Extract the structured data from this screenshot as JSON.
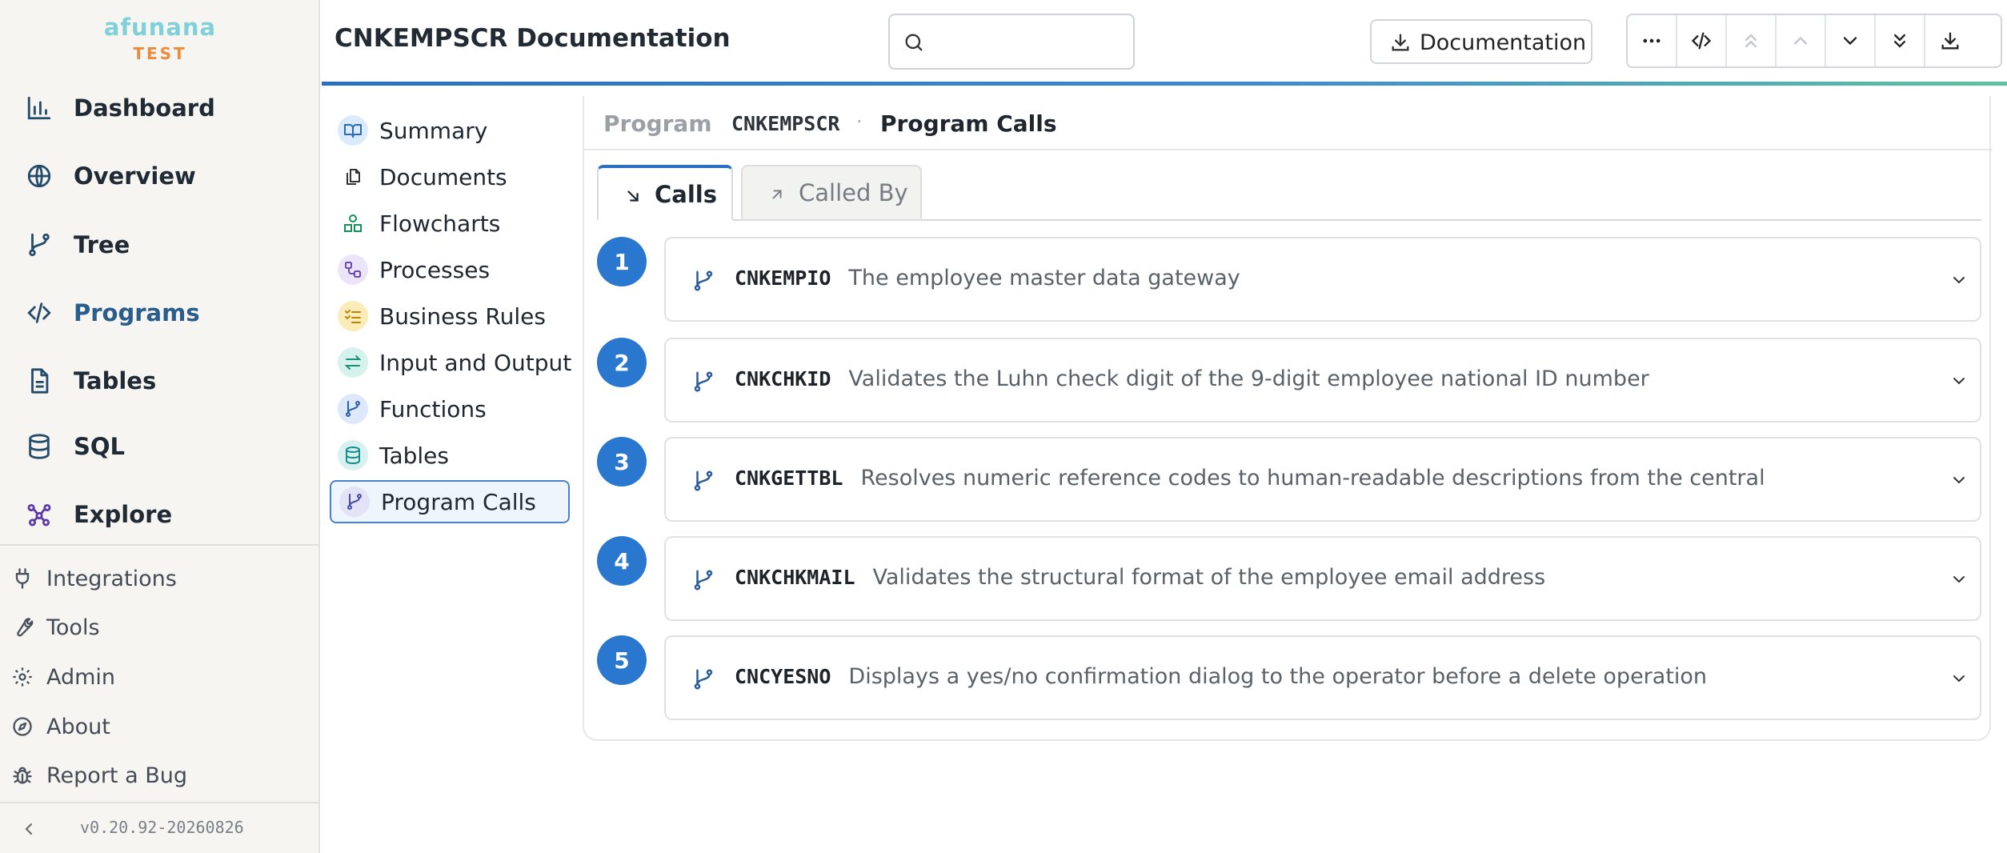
{
  "brand": {
    "name": "afunana",
    "env": "TEST"
  },
  "sidebar": {
    "items": [
      {
        "label": "Dashboard",
        "icon": "bar-chart-icon"
      },
      {
        "label": "Overview",
        "icon": "globe-icon"
      },
      {
        "label": "Tree",
        "icon": "git-branch-icon"
      },
      {
        "label": "Programs",
        "icon": "code-icon",
        "active": true
      },
      {
        "label": "Tables",
        "icon": "file-text-icon"
      },
      {
        "label": "SQL",
        "icon": "database-icon"
      },
      {
        "label": "Explore",
        "icon": "network-icon"
      }
    ],
    "secondary": [
      {
        "label": "Integrations",
        "icon": "plug-icon"
      },
      {
        "label": "Tools",
        "icon": "wrench-icon"
      },
      {
        "label": "Admin",
        "icon": "gear-icon"
      },
      {
        "label": "About",
        "icon": "compass-icon"
      },
      {
        "label": "Report a Bug",
        "icon": "bug-icon"
      }
    ],
    "version": "v0.20.92-20260826"
  },
  "header": {
    "title": "CNKEMPSCR Documentation",
    "search": {
      "value": "",
      "placeholder": ""
    },
    "doc_button_label": "Documentation"
  },
  "docnav": {
    "items": [
      {
        "label": "Summary",
        "icon": "book-open-icon"
      },
      {
        "label": "Documents",
        "icon": "files-icon"
      },
      {
        "label": "Flowcharts",
        "icon": "shapes-icon"
      },
      {
        "label": "Processes",
        "icon": "workflow-icon"
      },
      {
        "label": "Business Rules",
        "icon": "list-checks-icon"
      },
      {
        "label": "Input and Output",
        "icon": "arrows-exchange-icon"
      },
      {
        "label": "Functions",
        "icon": "git-branch-icon"
      },
      {
        "label": "Tables",
        "icon": "database-icon"
      },
      {
        "label": "Program Calls",
        "icon": "git-branch-icon",
        "active": true
      }
    ]
  },
  "breadcrumb": {
    "root": "Program",
    "sep": "·",
    "name": "CNKEMPSCR",
    "current": "Program Calls"
  },
  "tabs": {
    "calls": "Calls",
    "called_by": "Called By"
  },
  "calls": [
    {
      "num": "1",
      "name": "CNKEMPIO",
      "desc": "The employee master data gateway"
    },
    {
      "num": "2",
      "name": "CNKCHKID",
      "desc": "Validates the Luhn check digit of the 9-digit employee national ID number"
    },
    {
      "num": "3",
      "name": "CNKGETTBL",
      "desc": "Resolves numeric reference codes to human-readable descriptions from the central"
    },
    {
      "num": "4",
      "name": "CNKCHKMAIL",
      "desc": "Validates the structural format of the employee email address"
    },
    {
      "num": "5",
      "name": "CNCYESNO",
      "desc": "Displays a yes/no confirmation dialog to the operator before a delete operation"
    }
  ],
  "colors": {
    "accent": "#2a77cf",
    "brand": "#7fd0d8",
    "env": "#ee8a3b"
  }
}
